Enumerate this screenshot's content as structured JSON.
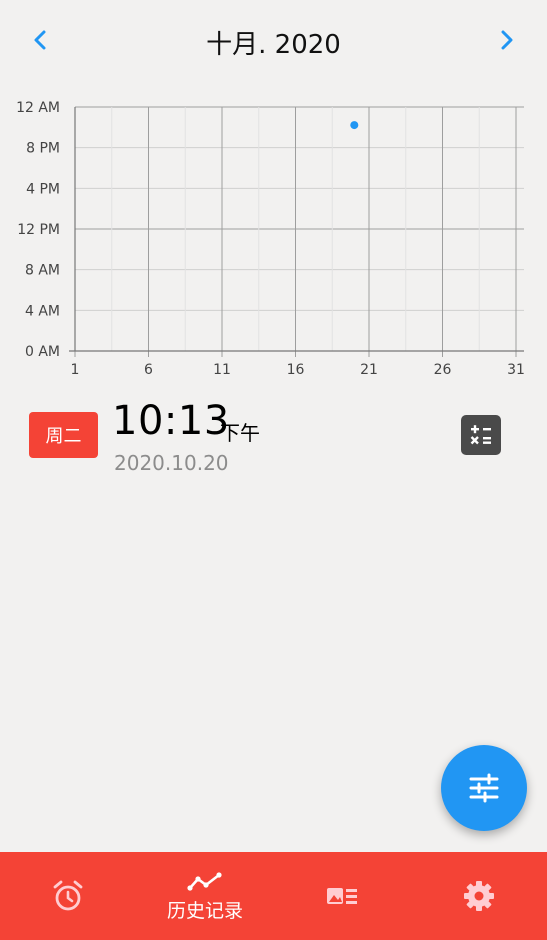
{
  "header": {
    "title": "十月. 2020",
    "prev_icon": "chevron-left-icon",
    "next_icon": "chevron-right-icon",
    "accent_color": "#2196f3"
  },
  "chart_data": {
    "type": "scatter",
    "x_ticks": [
      "1",
      "6",
      "11",
      "16",
      "21",
      "26",
      "31"
    ],
    "y_ticks": [
      "12 AM",
      "8 PM",
      "4 PM",
      "12 PM",
      "8 AM",
      "4 AM",
      "0 AM"
    ],
    "xlim": [
      1,
      31
    ],
    "ylim_hours": [
      0,
      24
    ],
    "points": [
      {
        "day": 20,
        "hour": 22.22
      }
    ],
    "point_color": "#2196f3",
    "grid": true
  },
  "record": {
    "weekday": "周二",
    "time": "10:13",
    "ampm": "下午",
    "date": "2020.10.20",
    "badge_color": "#f44336",
    "action_icon": "calculator-icon"
  },
  "fab": {
    "icon": "tune-sliders-icon",
    "color": "#2196f3"
  },
  "bottom_nav": {
    "background": "#f44336",
    "items": [
      {
        "icon": "alarm-clock-icon",
        "label": ""
      },
      {
        "icon": "history-line-icon",
        "label": "历史记录",
        "active": true
      },
      {
        "icon": "card-list-icon",
        "label": ""
      },
      {
        "icon": "gear-icon",
        "label": ""
      }
    ]
  }
}
